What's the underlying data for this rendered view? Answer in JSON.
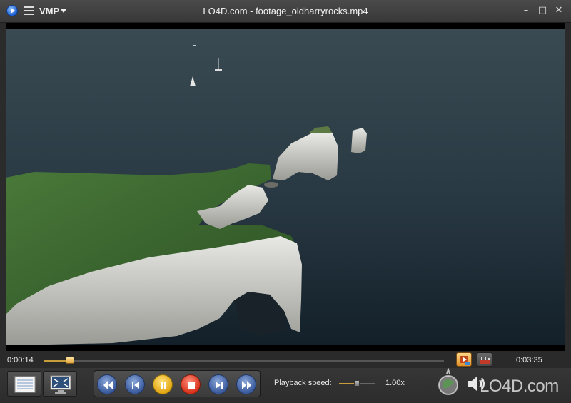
{
  "app": {
    "name": "VMP",
    "window_title": "LO4D.com - footage_oldharryrocks.mp4"
  },
  "window_controls": {
    "close_glyph": "✕",
    "maximize_glyph": "□",
    "minimize_glyph": "–"
  },
  "playback": {
    "elapsed": "0:00:14",
    "duration": "0:03:35",
    "progress_fraction": 0.065
  },
  "speed": {
    "label": "Playback speed:",
    "value": "1.00x",
    "slider_fraction": 0.5
  },
  "buttons": [
    {
      "name": "rewind-button",
      "icon": "rewind-icon",
      "color": "blue"
    },
    {
      "name": "previous-button",
      "icon": "skip-back-icon",
      "color": "blue"
    },
    {
      "name": "pause-button",
      "icon": "pause-icon",
      "color": "yellow"
    },
    {
      "name": "stop-button",
      "icon": "stop-icon",
      "color": "red"
    },
    {
      "name": "next-button",
      "icon": "skip-forward-icon",
      "color": "blue"
    },
    {
      "name": "fast-forward-button",
      "icon": "fast-forward-icon",
      "color": "blue"
    }
  ],
  "watermark": {
    "text": "LO4D.com"
  },
  "colors": {
    "accent": "#c79d3a",
    "titlebar": "#3f3f3f",
    "background": "#2b2b2b"
  }
}
